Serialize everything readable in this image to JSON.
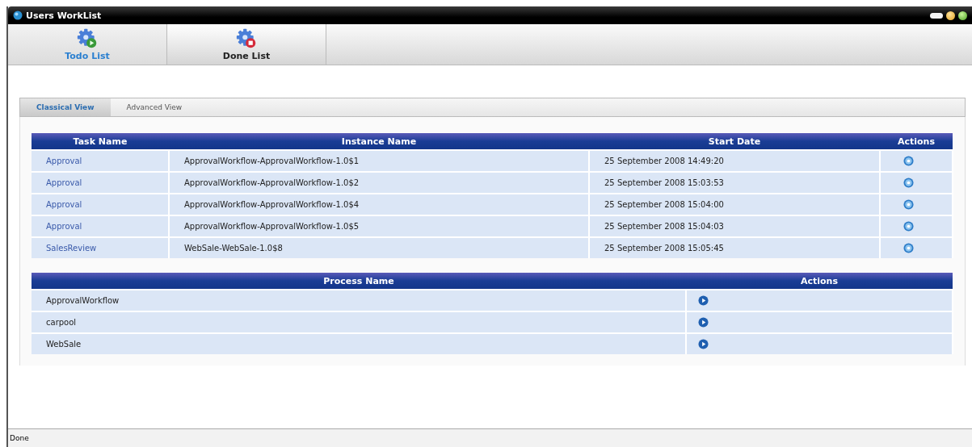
{
  "window": {
    "title": "Users WorkList"
  },
  "main_tabs": [
    {
      "label": "Todo List",
      "selected": true,
      "kind": "todo"
    },
    {
      "label": "Done List",
      "selected": false,
      "kind": "done"
    }
  ],
  "view_tabs": [
    {
      "label": "Classical View",
      "selected": true
    },
    {
      "label": "Advanced View",
      "selected": false
    }
  ],
  "tasks": {
    "columns": [
      "Task Name",
      "Instance Name",
      "Start Date",
      "Actions"
    ],
    "rows": [
      {
        "task": "Approval",
        "instance": "ApprovalWorkflow-ApprovalWorkflow-1.0$1",
        "start": "25 September 2008 14:49:20"
      },
      {
        "task": "Approval",
        "instance": "ApprovalWorkflow-ApprovalWorkflow-1.0$2",
        "start": "25 September 2008 15:03:53"
      },
      {
        "task": "Approval",
        "instance": "ApprovalWorkflow-ApprovalWorkflow-1.0$4",
        "start": "25 September 2008 15:04:00"
      },
      {
        "task": "Approval",
        "instance": "ApprovalWorkflow-ApprovalWorkflow-1.0$5",
        "start": "25 September 2008 15:04:03"
      },
      {
        "task": "SalesReview",
        "instance": "WebSale-WebSale-1.0$8",
        "start": "25 September 2008 15:05:45"
      }
    ]
  },
  "processes": {
    "columns": [
      "Process Name",
      "Actions"
    ],
    "rows": [
      {
        "name": "ApprovalWorkflow"
      },
      {
        "name": "carpool"
      },
      {
        "name": "WebSale"
      }
    ]
  },
  "status_bar": "Done"
}
